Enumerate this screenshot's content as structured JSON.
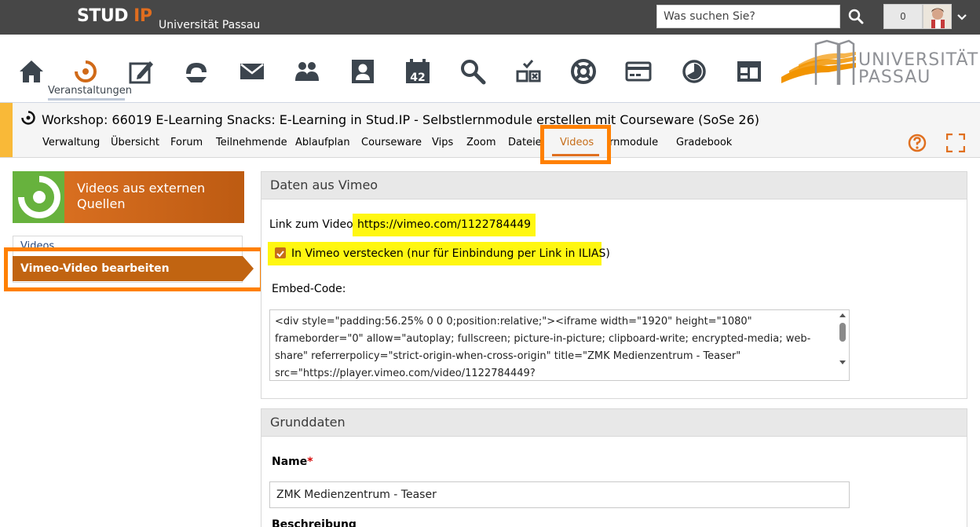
{
  "topbar": {
    "logo_main": "STUD",
    "logo_accent": "IP",
    "university": "Universität Passau",
    "search_placeholder": "Was suchen Sie?",
    "notifications_count": "0"
  },
  "iconnav": {
    "items": [
      "home-icon",
      "courses-icon",
      "mycourses-icon",
      "tools-icon",
      "messages-icon",
      "community-icon",
      "profile-icon",
      "calendar-icon",
      "search-icon",
      "vips-icon",
      "support-icon",
      "payment-icon",
      "stats-icon",
      "widgets-icon"
    ],
    "active_label": "Veranstaltungen",
    "calendar_day": "42",
    "logo_line1": "UNIVERSITÄT",
    "logo_line2": "PASSAU"
  },
  "course": {
    "title": "Workshop: 66019 E-Learning Snacks: E-Learning in Stud.IP - Selbstlernmodule erstellen mit Courseware (SoSe 26)",
    "tabs": [
      "Verwaltung",
      "Übersicht",
      "Forum",
      "Teilnehmende",
      "Ablaufplan",
      "Courseware",
      "Vips",
      "Zoom",
      "Dateien",
      "Videos",
      "Lernmodule",
      "Gradebook"
    ],
    "tab_visible": [
      "Verwaltung",
      "Übersicht",
      "Forum",
      "Teilnehmende",
      "Ablaufplan",
      "Courseware",
      "Vips",
      "Zoom",
      "Dateie",
      "Videos",
      "rnmodule",
      "Gradebook"
    ],
    "active_tab": "Videos"
  },
  "sidebar": {
    "banner_title": "Videos aus externen Quellen",
    "items": [
      {
        "label": "Videos",
        "active": false
      },
      {
        "label": "Vimeo-Video bearbeiten",
        "active": true
      }
    ]
  },
  "vimeo_panel": {
    "title": "Daten aus Vimeo",
    "link_label": "Link zum Video:",
    "link_url": "https://vimeo.com/1122784449",
    "hide_label": "In Vimeo verstecken (nur für Einbindung per Link in ILIAS)",
    "hide_checked": true,
    "embed_label": "Embed-Code:",
    "embed_code": "<div style=\"padding:56.25% 0 0 0;position:relative;\"><iframe width=\"1920\" height=\"1080\" frameborder=\"0\" allow=\"autoplay; fullscreen; picture-in-picture; clipboard-write; encrypted-media; web-share\" referrerpolicy=\"strict-origin-when-cross-origin\" title=\"ZMK Medienzentrum - Teaser\" src=\"https://player.vimeo.com/video/1122784449?"
  },
  "grund_panel": {
    "title": "Grunddaten",
    "name_label": "Name",
    "name_required": "*",
    "name_value": "ZMK Medienzentrum - Teaser",
    "desc_label": "Beschreibung"
  },
  "colors": {
    "topbar": "#474747",
    "accent_orange": "#c16411",
    "highlight_yellow": "#fff711",
    "annotation_orange": "#ff8000"
  }
}
